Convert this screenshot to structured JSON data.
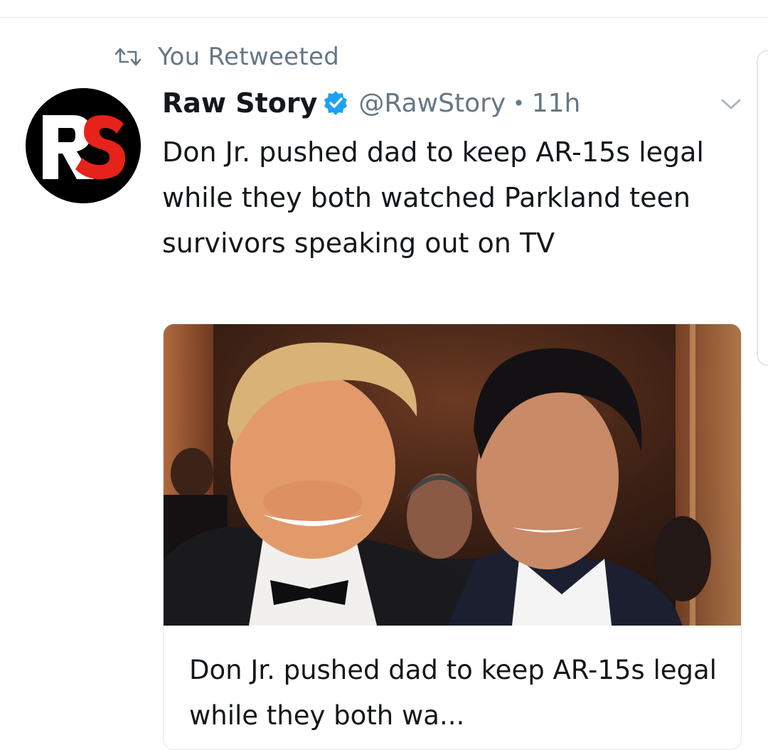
{
  "retweet_banner": {
    "icon": "retweet-icon",
    "text": "You Retweeted"
  },
  "author": {
    "avatar_text": "RS",
    "display_name": "Raw Story",
    "verified_icon": "verified-badge-icon",
    "handle": "@RawStory",
    "separator": "•",
    "time": "11h"
  },
  "menu": {
    "icon": "chevron-down-icon"
  },
  "tweet": {
    "text": "Don Jr. pushed dad to keep AR-15s legal while they both watched Parkland teen survivors speaking out on TV"
  },
  "link_card": {
    "title": "Don Jr. pushed dad to keep AR-15s legal while they both wa..."
  },
  "colors": {
    "secondary_text": "#657786",
    "verified_blue": "#1da1f2",
    "border": "#e1e8ed",
    "brand_red": "#e5231b"
  }
}
